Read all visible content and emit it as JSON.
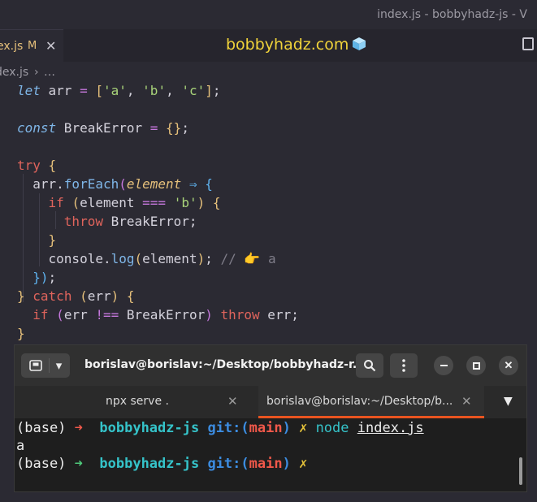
{
  "window": {
    "title": "index.js - bobbyhadz-js - V",
    "brand": "bobbyhadz.com"
  },
  "tab": {
    "name": "ex.js",
    "modified": "M",
    "close": "✕"
  },
  "breadcrumb": {
    "file": "dex.js",
    "sep": "›",
    "more": "…"
  },
  "code": {
    "l1": {
      "k": "let",
      "a": " arr ",
      "eq": "=",
      "b": " ",
      "o": "[",
      "s1": "'a'",
      "c1": ", ",
      "s2": "'b'",
      "c2": ", ",
      "s3": "'c'",
      "cl": "]",
      "end": ";"
    },
    "l2": {
      "k": "const",
      "a": " BreakError ",
      "eq": "=",
      "b": " ",
      "o": "{}",
      "end": ";"
    },
    "l3": {
      "k": "try",
      "b": " ",
      "o": "{"
    },
    "l4": {
      "a": "  arr.",
      "fn": "forEach",
      "o": "(",
      "p": "element",
      "b": " ",
      "ar": "⇒",
      "c": " ",
      "ob": "{"
    },
    "l5": {
      "a": "    ",
      "k": "if",
      "b": " ",
      "o": "(",
      "v": "element ",
      "eq": "===",
      "c": " ",
      "s": "'b'",
      "cl": ")",
      "d": " ",
      "ob": "{"
    },
    "l6": {
      "a": "      ",
      "k": "throw",
      "v": " BreakError;"
    },
    "l7": {
      "a": "    ",
      "cb": "}"
    },
    "l8": {
      "a": "    console.",
      "fn": "log",
      "o": "(",
      "v": "element",
      "cl": ")",
      "end": "; ",
      "cm": "// 👉 a"
    },
    "l9": {
      "a": "  ",
      "cb": "})",
      "end": ";"
    },
    "l10": {
      "cb": "}",
      "b": " ",
      "k": "catch",
      "c": " ",
      "o": "(",
      "v": "err",
      "cl": ")",
      "d": " ",
      "ob": "{"
    },
    "l11": {
      "a": "  ",
      "k": "if",
      "b": " ",
      "o": "(",
      "v": "err ",
      "ne": "!==",
      "c": " BreakError",
      "cl": ")",
      "d": " ",
      "k2": "throw",
      "e": " err;"
    },
    "l12": {
      "cb": "}"
    }
  },
  "terminal": {
    "title": "borislav@borislav:~/Desktop/bobbyhadz-r...",
    "tabs": [
      {
        "label": "npx serve .",
        "close": "✕"
      },
      {
        "label": "borislav@borislav:~/Desktop/b...",
        "close": "✕"
      }
    ],
    "lines": {
      "l1": {
        "base": "(base) ",
        "arrow": "➜",
        "sp": "  ",
        "dir": "bobbyhadz-js",
        "git": " git:(",
        "branch": "main",
        "gitc": ")",
        "x": " ✗ ",
        "cmd": "node",
        "sp2": " ",
        "file": "index.js"
      },
      "l2": {
        "out": "a"
      },
      "l3": {
        "base": "(base) ",
        "arrow": "➜",
        "sp": "  ",
        "dir": "bobbyhadz-js",
        "git": " git:(",
        "branch": "main",
        "gitc": ")",
        "x": " ✗"
      }
    }
  }
}
